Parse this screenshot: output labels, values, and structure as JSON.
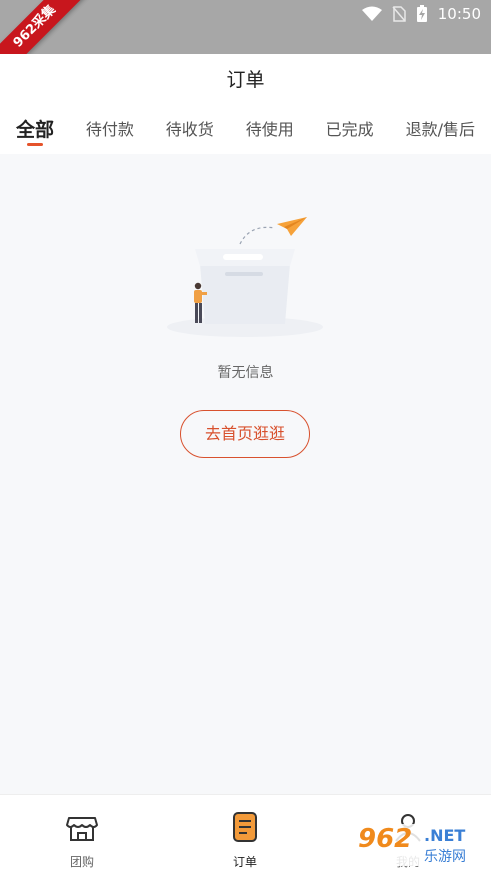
{
  "status_bar": {
    "time": "10:50"
  },
  "corner_ribbon": {
    "text": "962采集"
  },
  "header": {
    "title": "订单"
  },
  "tabs": [
    {
      "label": "全部",
      "active": true
    },
    {
      "label": "待付款",
      "active": false
    },
    {
      "label": "待收货",
      "active": false
    },
    {
      "label": "待使用",
      "active": false
    },
    {
      "label": "已完成",
      "active": false
    },
    {
      "label": "退款/售后",
      "active": false
    }
  ],
  "empty_state": {
    "message": "暂无信息",
    "button_label": "去首页逛逛"
  },
  "bottom_nav": [
    {
      "label": "团购",
      "icon": "shop-icon",
      "active": false
    },
    {
      "label": "订单",
      "icon": "order-icon",
      "active": true
    },
    {
      "label": "我的",
      "icon": "profile-icon",
      "active": false
    }
  ],
  "watermark": {
    "logo": "962",
    "net": ".NET",
    "cn": "乐游网"
  },
  "colors": {
    "accent": "#e5532b",
    "button_border": "#d8512e",
    "background": "#f7f8fa",
    "status_bar": "#a7a7a7"
  }
}
